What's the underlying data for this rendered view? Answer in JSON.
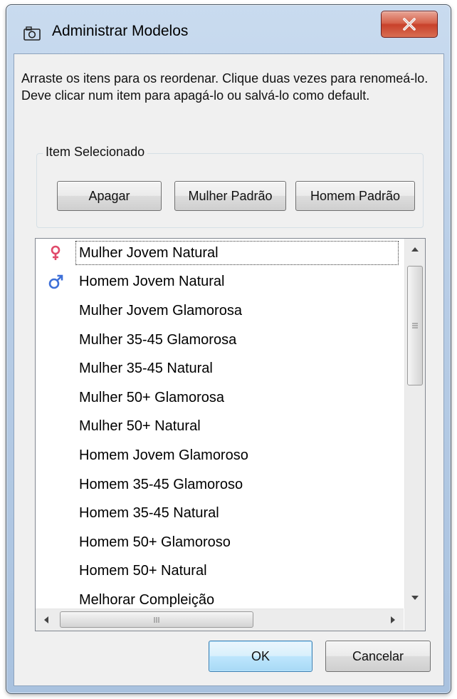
{
  "window": {
    "title": "Administrar Modelos",
    "close_label": "Fechar"
  },
  "instructions": "Arraste os itens para os reordenar. Clique duas vezes para renomeá-lo.  Deve clicar num item para apagá-lo ou salvá-lo como default.",
  "selected_group": {
    "label": "Item Selecionado",
    "buttons": {
      "delete": "Apagar",
      "female_default": "Mulher Padrão",
      "male_default": "Homem Padrão"
    }
  },
  "list": {
    "items": [
      {
        "label": "Mulher Jovem Natural",
        "icon": "female-symbol-icon",
        "focused": true
      },
      {
        "label": "Homem Jovem Natural",
        "icon": "male-symbol-icon"
      },
      {
        "label": "Mulher Jovem Glamorosa"
      },
      {
        "label": "Mulher 35-45 Glamorosa"
      },
      {
        "label": "Mulher 35-45 Natural"
      },
      {
        "label": "Mulher 50+ Glamorosa"
      },
      {
        "label": "Mulher 50+ Natural"
      },
      {
        "label": "Homem Jovem Glamoroso"
      },
      {
        "label": "Homem 35-45 Glamoroso"
      },
      {
        "label": "Homem 35-45 Natural"
      },
      {
        "label": "Homem 50+ Glamoroso"
      },
      {
        "label": "Homem 50+ Natural"
      },
      {
        "label": "Melhorar Compleição"
      }
    ],
    "vertical_scroll_fraction": 0.0,
    "horizontal_scroll_fraction": 0.0
  },
  "footer": {
    "ok": "OK",
    "cancel": "Cancelar"
  },
  "colors": {
    "female_icon": "#e04a6a",
    "male_icon": "#3d6fd8",
    "close_button": "#c8412b",
    "title_bar": "#b8cde6"
  }
}
